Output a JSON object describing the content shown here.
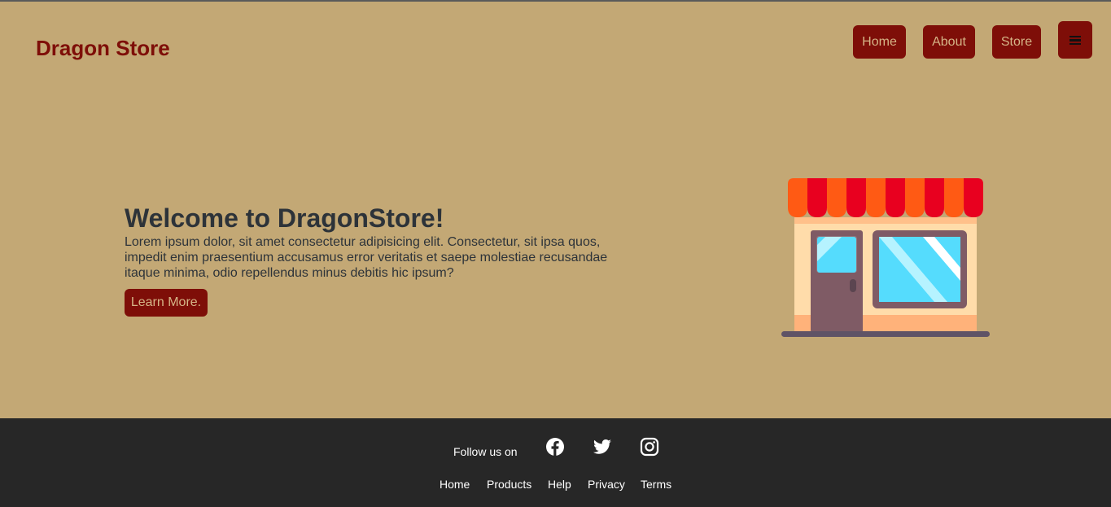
{
  "brand": "Dragon Store",
  "nav": {
    "home": "Home",
    "about": "About",
    "store": "Store"
  },
  "menu_icon": "hamburger-menu-icon",
  "hero": {
    "title": "Welcome to DragonStore!",
    "text": "Lorem ipsum dolor, sit amet consectetur adipisicing elit. Consectetur, sit ipsa quos, impedit enim praesentium accusamus error veritatis et saepe molestiae recusandae itaque minima, odio repellendus minus debitis hic ipsum?",
    "button": "Learn More.",
    "illustration": "storefront-illustration"
  },
  "footer": {
    "follow_label": "Follow us on",
    "social_icons": [
      "facebook-icon",
      "twitter-icon",
      "instagram-icon"
    ],
    "links": {
      "home": "Home",
      "products": "Products",
      "help": "Help",
      "privacy": "Privacy",
      "terms": "Terms"
    }
  },
  "colors": {
    "background": "#c3a875",
    "accent": "#7e0e08",
    "button_text": "#d5b587",
    "heading_text": "#2d3339",
    "footer_bg": "#272727"
  }
}
